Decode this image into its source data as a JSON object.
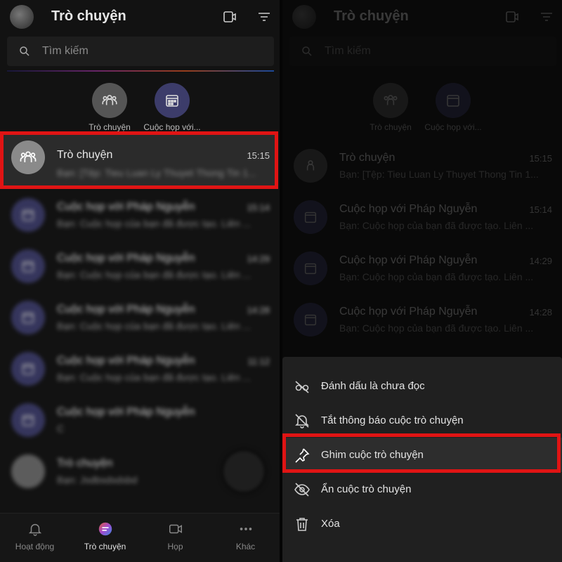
{
  "left": {
    "header": {
      "title": "Trò chuyện"
    },
    "search": {
      "placeholder": "Tìm kiếm"
    },
    "pinned": [
      {
        "label": "Trò chuyện",
        "icon": "group-icon"
      },
      {
        "label": "Cuộc họp với...",
        "icon": "calendar-icon"
      }
    ],
    "chats": [
      {
        "name": "Trò chuyện",
        "time": "15:15",
        "preview": "Bạn: [Tệp: Tieu Luan Ly Thuyet Thong Tin 1...",
        "icon": "group-icon"
      },
      {
        "name": "Cuộc họp với Pháp Nguyễn",
        "time": "15:14",
        "preview": "Bạn: Cuộc họp của bạn đã được tạo. Liên ...",
        "icon": "calendar-icon"
      },
      {
        "name": "Cuộc họp với Pháp Nguyễn",
        "time": "14:29",
        "preview": "Bạn: Cuộc họp của bạn đã được tạo. Liên ...",
        "icon": "calendar-icon"
      },
      {
        "name": "Cuộc họp với Pháp Nguyễn",
        "time": "14:28",
        "preview": "Bạn: Cuộc họp của bạn đã được tạo. Liên ...",
        "icon": "calendar-icon"
      },
      {
        "name": "Cuộc họp với Pháp Nguyễn",
        "time": "11:12",
        "preview": "Bạn: Cuộc họp của bạn đã được tạo. Liên ...",
        "icon": "calendar-icon"
      },
      {
        "name": "Cuộc họp với Pháp Nguyễn",
        "time": "",
        "preview": "C",
        "icon": "calendar-icon"
      },
      {
        "name": "Trò chuyện",
        "time": "",
        "preview": "Bạn: Jsdbsdsdsbd",
        "icon": "group-icon"
      }
    ],
    "tabs": [
      {
        "label": "Hoạt động",
        "icon": "bell-icon"
      },
      {
        "label": "Trò chuyện",
        "icon": "chat-icon"
      },
      {
        "label": "Họp",
        "icon": "video-icon"
      },
      {
        "label": "Khác",
        "icon": "more-icon"
      }
    ]
  },
  "right": {
    "header": {
      "title": "Trò chuyện"
    },
    "search": {
      "placeholder": "Tìm kiếm"
    },
    "pinned": [
      {
        "label": "Trò chuyện"
      },
      {
        "label": "Cuộc họp với..."
      }
    ],
    "chats": [
      {
        "name": "Trò chuyện",
        "time": "15:15",
        "preview": "Bạn: [Tệp: Tieu Luan Ly Thuyet Thong Tin 1..."
      },
      {
        "name": "Cuộc họp với Pháp Nguyễn",
        "time": "15:14",
        "preview": "Bạn: Cuộc họp của bạn đã được tạo. Liên ..."
      },
      {
        "name": "Cuộc họp với Pháp Nguyễn",
        "time": "14:29",
        "preview": "Bạn: Cuộc họp của bạn đã được tạo. Liên ..."
      },
      {
        "name": "Cuộc họp với Pháp Nguyễn",
        "time": "14:28",
        "preview": "Bạn: Cuộc họp của bạn đã được tạo. Liên ..."
      }
    ],
    "menu": [
      {
        "label": "Đánh dấu là chưa đọc",
        "icon": "mark-unread-icon"
      },
      {
        "label": "Tắt thông báo cuộc trò chuyện",
        "icon": "bell-off-icon"
      },
      {
        "label": "Ghim cuộc trò chuyện",
        "icon": "pin-icon"
      },
      {
        "label": "Ẩn cuộc trò chuyện",
        "icon": "eye-off-icon"
      },
      {
        "label": "Xóa",
        "icon": "trash-icon"
      }
    ]
  },
  "colors": {
    "highlight": "#e01414",
    "calendar_avatar": "#3c3c6a",
    "group_avatar": "#8a8a8a"
  }
}
